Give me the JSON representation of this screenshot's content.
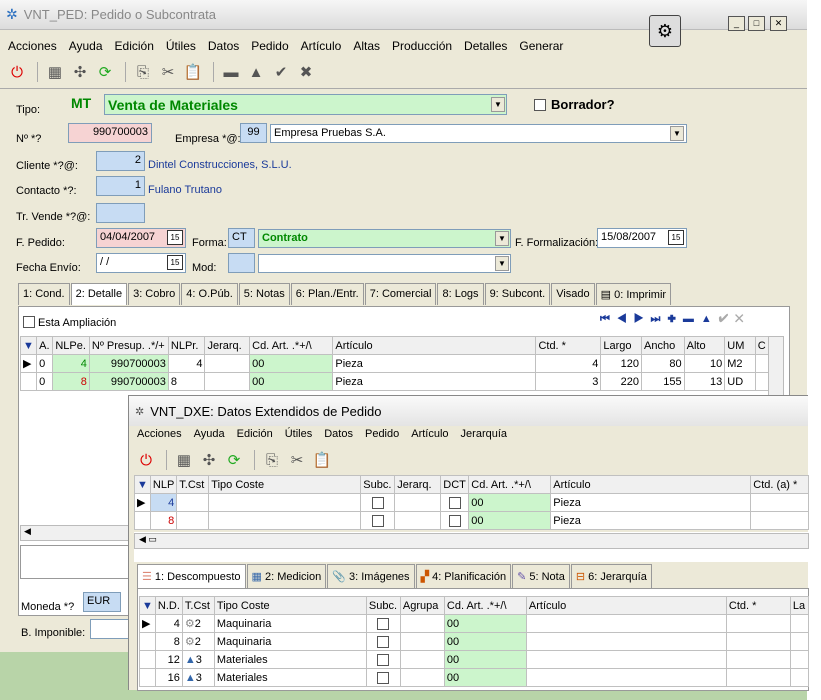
{
  "main": {
    "title": "VNT_PED: Pedido o Subcontrata",
    "menu": [
      "Acciones",
      "Ayuda",
      "Edición",
      "Útiles",
      "Datos",
      "Pedido",
      "Artículo",
      "Altas",
      "Producción",
      "Detalles",
      "Generar"
    ],
    "tipo_label": "Tipo:",
    "tipo_code": "MT",
    "tipo_value": "Venta de Materiales",
    "borrador_label": "Borrador?",
    "num_label": "Nº *?",
    "num_value": "990700003",
    "empresa_label": "Empresa *@:",
    "empresa_code": "99",
    "empresa_value": "Empresa Pruebas S.A.",
    "cliente_label": "Cliente *?@:",
    "cliente_code": "2",
    "cliente_value": "Dintel Construcciones, S.L.U.",
    "contacto_label": "Contacto *?:",
    "contacto_code": "1",
    "contacto_value": "Fulano Trutano",
    "vende_label": "Tr. Vende *?@:",
    "fpedido_label": "F. Pedido:",
    "fpedido_value": "04/04/2007",
    "forma_label": "Forma:",
    "forma_code": "CT",
    "forma_value": "Contrato",
    "fform_label": "F. Formalización:",
    "fform_value": "15/08/2007",
    "fenvio_label": "Fecha Envío:",
    "fenvio_value": " / /",
    "mod_label": "Mod:",
    "tabs": [
      "1: Cond.",
      "2: Detalle",
      "3: Cobro",
      "4: O.Púb.",
      "5: Notas",
      "6: Plan./Entr.",
      "7: Comercial",
      "8: Logs",
      "9: Subcont.",
      "Visado",
      "0: Imprimir"
    ],
    "ampliacion_label": "Esta Ampliación",
    "grid_headers": [
      "A.",
      "NLPe.",
      "Nº Presup. .*/+",
      "NLPr.",
      "Jerarq.",
      "Cd. Art. .*+/\\",
      "Artículo",
      "Ctd. *",
      "Largo",
      "Ancho",
      "Alto",
      "UM",
      "C"
    ],
    "grid_rows": [
      [
        "0",
        "4",
        "990700003",
        "4",
        "",
        "00",
        "Pieza",
        "4",
        "120",
        "80",
        "10",
        "M2",
        ""
      ],
      [
        "0",
        "8",
        "990700003",
        "8",
        "",
        "00",
        "Pieza",
        "3",
        "220",
        "155",
        "13",
        "UD",
        ""
      ]
    ],
    "moneda_label": "Moneda *?",
    "moneda_value": "EUR",
    "imponible_label": "B. Imponible:"
  },
  "sub": {
    "title": "VNT_DXE: Datos Extendidos de Pedido",
    "menu": [
      "Acciones",
      "Ayuda",
      "Edición",
      "Útiles",
      "Datos",
      "Pedido",
      "Artículo",
      "Jerarquía"
    ],
    "grid_headers": [
      "NLP",
      "T.Cst",
      "Tipo Coste",
      "Subc.",
      "Jerarq.",
      "DCT",
      "Cd. Art. .*+/\\",
      "Artículo",
      "Ctd. (a) *"
    ],
    "grid_rows": [
      [
        "4",
        "",
        "",
        "",
        "",
        "",
        "00",
        "Pieza",
        ""
      ],
      [
        "8",
        "",
        "",
        "",
        "",
        "",
        "00",
        "Pieza",
        ""
      ]
    ],
    "tabs": [
      "1: Descompuesto",
      "2: Medicion",
      "3: Imágenes",
      "4: Planificación",
      "5: Nota",
      "6: Jerarquía"
    ],
    "grid2_headers": [
      "N.D.",
      "T.Cst",
      "Tipo Coste",
      "Subc.",
      "Agrupa",
      "Cd. Art. .*+/\\",
      "Artículo",
      "Ctd. *",
      "La"
    ],
    "grid2_rows": [
      [
        "4",
        "2",
        "Maquinaria",
        "",
        "",
        "00",
        "",
        "",
        ""
      ],
      [
        "8",
        "2",
        "Maquinaria",
        "",
        "",
        "00",
        "",
        "",
        ""
      ],
      [
        "12",
        "3",
        "Materiales",
        "",
        "",
        "00",
        "",
        "",
        ""
      ],
      [
        "16",
        "3",
        "Materiales",
        "",
        "",
        "00",
        "",
        "",
        ""
      ]
    ]
  }
}
